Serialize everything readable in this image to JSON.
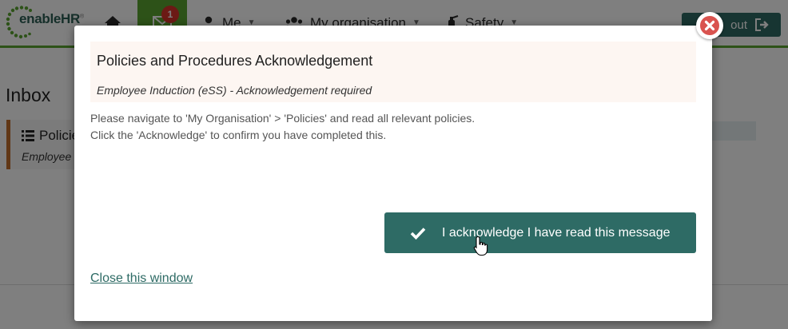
{
  "app": {
    "logo_text": "enableHR",
    "logo_mark": "®",
    "nav": {
      "me": "Me",
      "my_organisation": "My organisation",
      "safety": "Safety",
      "inbox_badge": "1"
    },
    "logout_label": "out",
    "inbox_heading": "Inbox",
    "inbox_item": {
      "title": "Policie",
      "subtitle": "Employee"
    }
  },
  "modal": {
    "title": "Policies and Procedures Acknowledgement",
    "subtitle": "Employee Induction (eSS) - Acknowledgement required",
    "body_line1": "Please navigate to 'My Organisation' > 'Policies' and read all relevant policies.",
    "body_line2": "Click the 'Acknowledge' to confirm you have completed this.",
    "acknowledge_label": "I acknowledge I have read this message",
    "close_link": "Close this window"
  },
  "colors": {
    "brand_green": "#5aa531",
    "brand_teal": "#2e6b65",
    "badge_red": "#d9342b",
    "close_red": "#d9534f",
    "accent_orange": "#c26e2b"
  },
  "icons": [
    "home-icon",
    "mail-icon",
    "user-icon",
    "users-icon",
    "safety-icon",
    "logout-icon",
    "list-icon",
    "check-icon",
    "close-icon",
    "hand-cursor-icon"
  ]
}
